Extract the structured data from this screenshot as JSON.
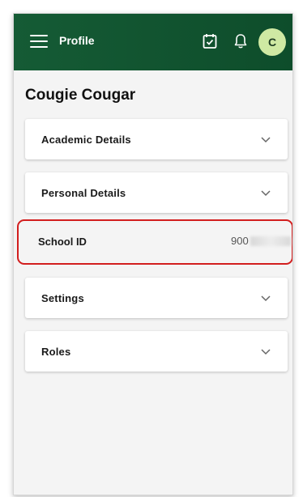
{
  "appbar": {
    "title": "Profile",
    "avatar_initial": "C",
    "background_color": "#155b35",
    "icons": [
      "menu-icon",
      "calendar-check-icon",
      "bell-icon"
    ]
  },
  "profile": {
    "name": "Cougie Cougar"
  },
  "sections": [
    {
      "label": "Academic Details",
      "expandable": true
    },
    {
      "label": "Personal Details",
      "expandable": true
    },
    {
      "label": "School ID",
      "expandable": false,
      "value_visible": "900",
      "value_redacted": true
    },
    {
      "label": "Settings",
      "expandable": true
    },
    {
      "label": "Roles",
      "expandable": true
    }
  ],
  "highlight_color": "#d21e1e"
}
